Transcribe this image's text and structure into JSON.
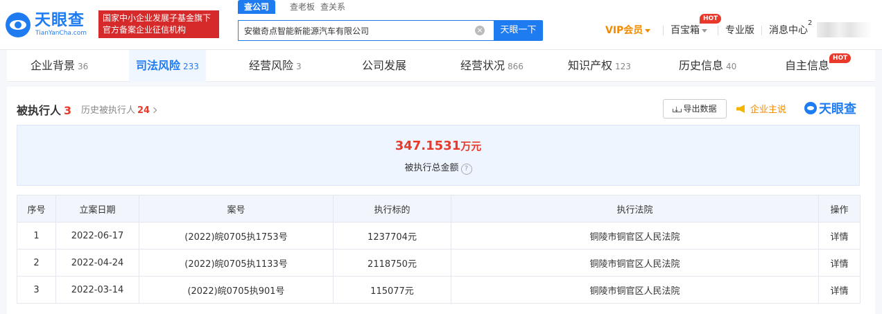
{
  "header": {
    "logo_cn": "天眼查",
    "logo_en": "TianYanCha.com",
    "slogan_line1": "国家中小企业发展子基金旗下",
    "slogan_line2": "官方备案企业征信机构",
    "search_tabs": [
      "查公司",
      "查老板",
      "查关系"
    ],
    "search_value": "安徽奇点智能新能源汽车有限公司",
    "search_button": "天眼一下",
    "nav": {
      "vip": "VIP会员",
      "baibaoxiang": "百宝箱",
      "hot": "HOT",
      "pro": "专业版",
      "messages": "消息中心",
      "message_count": "2"
    }
  },
  "categories": [
    {
      "label": "企业背景",
      "count": "36"
    },
    {
      "label": "司法风险",
      "count": "233"
    },
    {
      "label": "经营风险",
      "count": "3"
    },
    {
      "label": "公司发展",
      "count": ""
    },
    {
      "label": "经营状况",
      "count": "866"
    },
    {
      "label": "知识产权",
      "count": "123"
    },
    {
      "label": "历史信息",
      "count": "40"
    },
    {
      "label": "自主信息",
      "count": ""
    }
  ],
  "category_hot": "HOT",
  "section": {
    "title": "被执行人",
    "count": "3",
    "history_label": "历史被执行人",
    "history_count": "24",
    "export": "导出数据",
    "brand_say": "企业主说",
    "brand_logo": "天眼查"
  },
  "summary": {
    "amount": "347.1531",
    "unit": "万元",
    "label": "被执行总金额",
    "help": "?"
  },
  "table": {
    "headers": [
      "序号",
      "立案日期",
      "案号",
      "执行标的",
      "执行法院",
      "操作"
    ],
    "rows": [
      [
        "1",
        "2022-06-17",
        "(2022)皖0705执1753号",
        "1237704元",
        "铜陵市铜官区人民法院",
        "详情"
      ],
      [
        "2",
        "2022-04-24",
        "(2022)皖0705执1133号",
        "2118750元",
        "铜陵市铜官区人民法院",
        "详情"
      ],
      [
        "3",
        "2022-03-14",
        "(2022)皖0705执901号",
        "115077元",
        "铜陵市铜官区人民法院",
        "详情"
      ]
    ]
  },
  "colors": {
    "brand_blue": "#1f7cf0",
    "alert_red": "#e8392b",
    "vip_orange": "#f28a00"
  }
}
